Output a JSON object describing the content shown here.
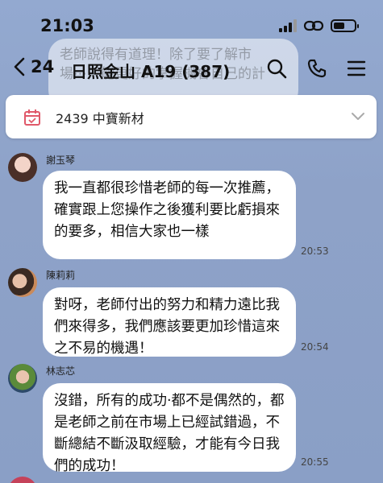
{
  "status_bar": {
    "time": "21:03"
  },
  "header": {
    "unread_count": "24",
    "room_title": "日照金山 A19 (387)"
  },
  "faded_message": "老師說得有道理！除了要了解市場⋯⋯能更好的掌握機會自己的計",
  "announcement": {
    "text": "2439 中寶新材"
  },
  "messages": [
    {
      "sender": "謝玉琴",
      "text": "我一直都很珍惜老師的每一次推薦，確實跟上您操作之後獲利要比虧損來的要多，相信大家也一樣",
      "time": "20:53"
    },
    {
      "sender": "陳莉莉",
      "text": "對呀，老師付出的努力和精力遠比我們來得多，我們應該要更加珍惜這來之不易的機遇！",
      "time": "20:54"
    },
    {
      "sender": "林志芯",
      "text": "沒錯，所有的成功·都不是偶然的，都是老師之前在市場上已經試錯過，不斷總結不斷汲取經驗，才能有今日我們的成功！",
      "time": "20:55"
    },
    {
      "sender": ""
    }
  ],
  "colors": {
    "chat_background": "#8fa3c9",
    "bubble": "#ffffff",
    "announce_icon": "#e0596a"
  }
}
